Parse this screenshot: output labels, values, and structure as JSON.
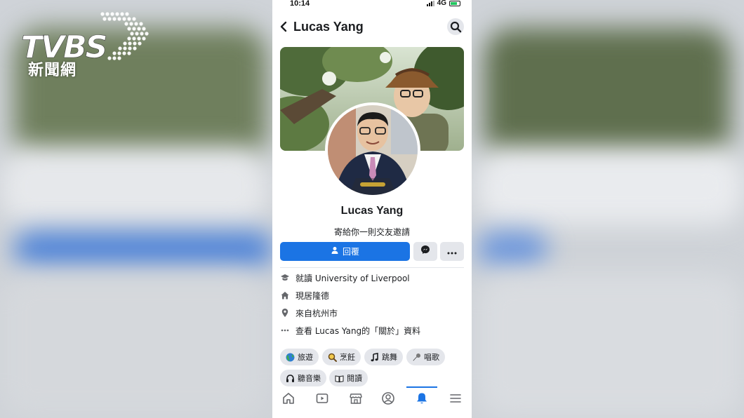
{
  "broadcaster": {
    "logo_letters": "TVBS",
    "logo_subtitle": "新聞網"
  },
  "status_bar": {
    "time": "10:14",
    "network": "4G"
  },
  "header": {
    "title": "Lucas Yang",
    "back_icon": "chevron-left-icon",
    "search_icon": "search-icon"
  },
  "profile": {
    "name": "Lucas Yang",
    "request_text": "寄給你一則交友邀請",
    "reply_label": "回覆"
  },
  "details": [
    {
      "icon": "graduation-cap-icon",
      "text": "就讀 University of Liverpool"
    },
    {
      "icon": "home-icon",
      "text": "現居隆德"
    },
    {
      "icon": "location-pin-icon",
      "text": "來自杭州市"
    },
    {
      "icon": "more-horizontal-icon",
      "text": "查看 Lucas Yang的「關於」資料"
    }
  ],
  "hobbies": [
    {
      "icon": "globe-icon",
      "label": "旅遊"
    },
    {
      "icon": "magnifier-icon",
      "label": "烹飪"
    },
    {
      "icon": "music-note-icon",
      "label": "跳舞"
    },
    {
      "icon": "microphone-icon",
      "label": "唱歌"
    },
    {
      "icon": "headphones-icon",
      "label": "聽音樂"
    },
    {
      "icon": "book-icon",
      "label": "閱讀"
    }
  ],
  "tab_bar": {
    "tabs": [
      "home-icon",
      "video-icon",
      "marketplace-icon",
      "profile-icon",
      "bell-icon",
      "menu-icon"
    ],
    "active": "bell-icon"
  },
  "colors": {
    "accent": "#1b74e4",
    "button_gray": "#e4e6eb",
    "text": "#1c1e21"
  }
}
